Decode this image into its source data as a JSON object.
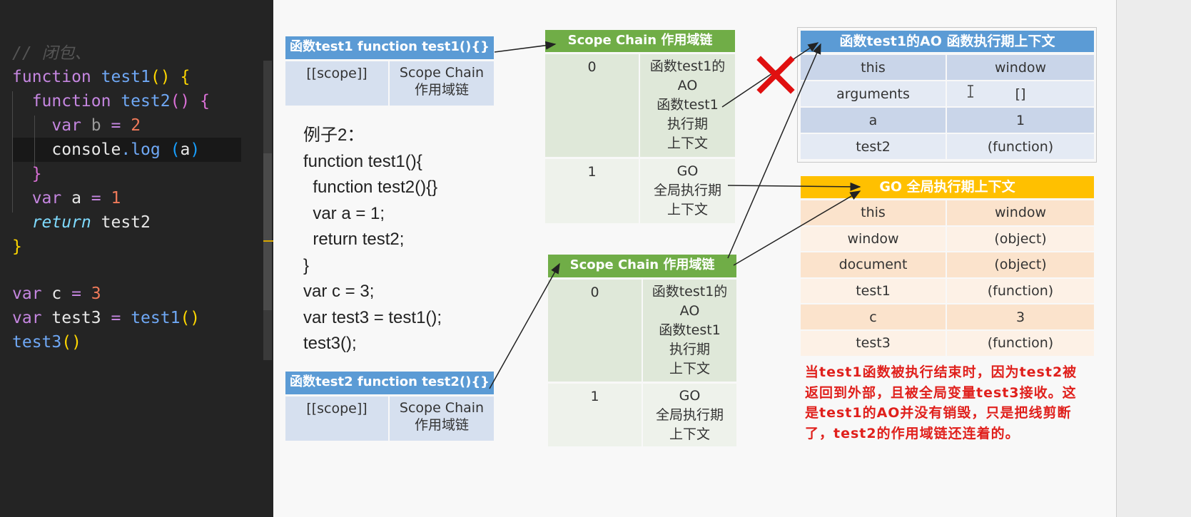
{
  "editor": {
    "lines": [
      [
        [
          "// 闭包、",
          "#555555",
          true
        ]
      ],
      [
        [
          "function ",
          "#c586e0"
        ],
        [
          "test1",
          "#6fa8f5"
        ],
        [
          "()",
          "#ffd700"
        ],
        [
          " ",
          "#ddd"
        ],
        [
          "{",
          "#ffd700"
        ]
      ],
      [
        [
          "  function ",
          "#c586e0"
        ],
        [
          "test2",
          "#6fa8f5"
        ],
        [
          "()",
          "#da70d6"
        ],
        [
          " ",
          "#ddd"
        ],
        [
          "{",
          "#da70d6"
        ]
      ],
      [
        [
          "    var ",
          "#c586e0"
        ],
        [
          "b",
          "#9a9a9a"
        ],
        [
          " = ",
          "#c586e0"
        ],
        [
          "2",
          "#f07a5a"
        ]
      ],
      [
        [
          "    console",
          "#e8e8e8"
        ],
        [
          ".",
          "#6fa8f5"
        ],
        [
          "log",
          "#6fa8f5"
        ],
        [
          " ",
          "#ddd"
        ],
        [
          "(",
          "#179fff"
        ],
        [
          "a",
          "#e8e8e8"
        ],
        [
          ")",
          "#179fff"
        ]
      ],
      [
        [
          "  }",
          "#da70d6"
        ]
      ],
      [
        [
          "  var ",
          "#c586e0"
        ],
        [
          "a",
          "#e8e8e8"
        ],
        [
          " = ",
          "#c586e0"
        ],
        [
          "1",
          "#f07a5a"
        ]
      ],
      [
        [
          "  return",
          "#7fdbff",
          true
        ],
        [
          " test2",
          "#e8e8e8"
        ]
      ],
      [
        [
          "}",
          "#ffd700"
        ]
      ],
      [],
      [
        [
          "var ",
          "#c586e0"
        ],
        [
          "c",
          "#e8e8e8"
        ],
        [
          " = ",
          "#c586e0"
        ],
        [
          "3",
          "#f07a5a"
        ]
      ],
      [
        [
          "var ",
          "#c586e0"
        ],
        [
          "test3",
          "#e8e8e8"
        ],
        [
          " = ",
          "#c586e0"
        ],
        [
          "test1",
          "#6fa8f5"
        ],
        [
          "()",
          "#ffd700"
        ]
      ],
      [
        [
          "test3",
          "#6fa8f5"
        ],
        [
          "()",
          "#ffd700"
        ]
      ]
    ]
  },
  "slide": {
    "test1_box": {
      "header": "函数test1  function test1(){}",
      "scope": "[[scope]]",
      "chain": "Scope Chain\n作用域链"
    },
    "test2_box": {
      "header": "函数test2  function test2(){}",
      "scope": "[[scope]]",
      "chain": "Scope Chain\n作用域链"
    },
    "example_code": "例子2：\nfunction test1(){\n  function test2(){}\n  var a = 1;\n  return test2;\n}\nvar c = 3;\nvar test3 = test1();\ntest3();",
    "scope_chain_1": {
      "header": "Scope Chain 作用域链",
      "rows": [
        {
          "idx": "0",
          "val": "函数test1的\nAO\n函数test1\n执行期\n上下文"
        },
        {
          "idx": "1",
          "val": "GO\n全局执行期\n上下文"
        }
      ]
    },
    "scope_chain_2": {
      "header": "Scope Chain 作用域链",
      "rows": [
        {
          "idx": "0",
          "val": "函数test1的\nAO\n函数test1\n执行期\n上下文"
        },
        {
          "idx": "1",
          "val": "GO\n全局执行期\n上下文"
        }
      ]
    },
    "ao_table": {
      "header": "函数test1的AO 函数执行期上下文",
      "rows": [
        [
          "this",
          "window"
        ],
        [
          "arguments",
          "[]"
        ],
        [
          "a",
          "1"
        ],
        [
          "test2",
          "(function)"
        ]
      ]
    },
    "go_table": {
      "header": "GO 全局执行期上下文",
      "rows": [
        [
          "this",
          "window"
        ],
        [
          "window",
          "(object)"
        ],
        [
          "document",
          "(object)"
        ],
        [
          "test1",
          "(function)"
        ],
        [
          "c",
          "3"
        ],
        [
          "test3",
          "(function)"
        ]
      ]
    },
    "note": "当test1函数被执行结束时，因为test2被返回到外部，且被全局变量test3接收。这是test1的AO并没有销毁，只是把线剪断了，test2的作用域链还连着的。",
    "colors": {
      "blue": "#5b9bd5",
      "blue_cell": "#d6e0ef",
      "green": "#70ad47",
      "green_cell": "#dfe8d9",
      "orange": "#ffc000",
      "note": "#e0201c"
    }
  }
}
